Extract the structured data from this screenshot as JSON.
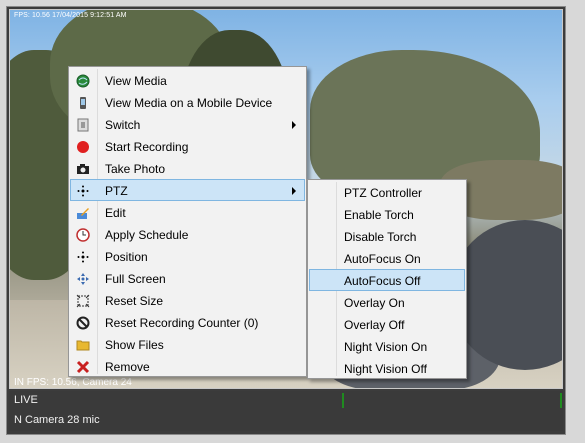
{
  "feed": {
    "top_stamp": "FPS: 10.56 17/04/2015 9:12:51 AM",
    "camera_label": "IN  FPS: 10.56, Camera 24"
  },
  "status": {
    "live": "LIVE",
    "camera": "N  Camera 28 mic"
  },
  "context_menu": {
    "items": [
      {
        "label": "View Media",
        "icon": "globe-icon"
      },
      {
        "label": "View Media on a Mobile Device",
        "icon": "mobile-icon"
      },
      {
        "label": "Switch",
        "icon": "switch-icon"
      },
      {
        "label": "Start Recording",
        "icon": "record-icon"
      },
      {
        "label": "Take Photo",
        "icon": "camera-icon"
      },
      {
        "label": "PTZ",
        "icon": "ptz-icon"
      },
      {
        "label": "Edit",
        "icon": "edit-icon"
      },
      {
        "label": "Apply Schedule",
        "icon": "clock-icon"
      },
      {
        "label": "Position",
        "icon": "position-icon"
      },
      {
        "label": "Full Screen",
        "icon": "fullscreen-icon"
      },
      {
        "label": "Reset Size",
        "icon": "reset-size-icon"
      },
      {
        "label": "Reset Recording Counter (0)",
        "icon": "no-icon"
      },
      {
        "label": "Show Files",
        "icon": "folder-icon"
      },
      {
        "label": "Remove",
        "icon": "remove-icon"
      }
    ]
  },
  "ptz_submenu": {
    "items": [
      {
        "label": "PTZ Controller"
      },
      {
        "label": "Enable Torch"
      },
      {
        "label": "Disable Torch"
      },
      {
        "label": "AutoFocus On"
      },
      {
        "label": "AutoFocus Off"
      },
      {
        "label": "Overlay On"
      },
      {
        "label": "Overlay Off"
      },
      {
        "label": "Night Vision On"
      },
      {
        "label": "Night Vision Off"
      }
    ]
  },
  "colors": {
    "highlight": "#cce4f7",
    "highlight_border": "#7fb6e1",
    "record_red": "#e02020",
    "remove_red": "#c82020",
    "live_tick": "#1f8b1f"
  }
}
